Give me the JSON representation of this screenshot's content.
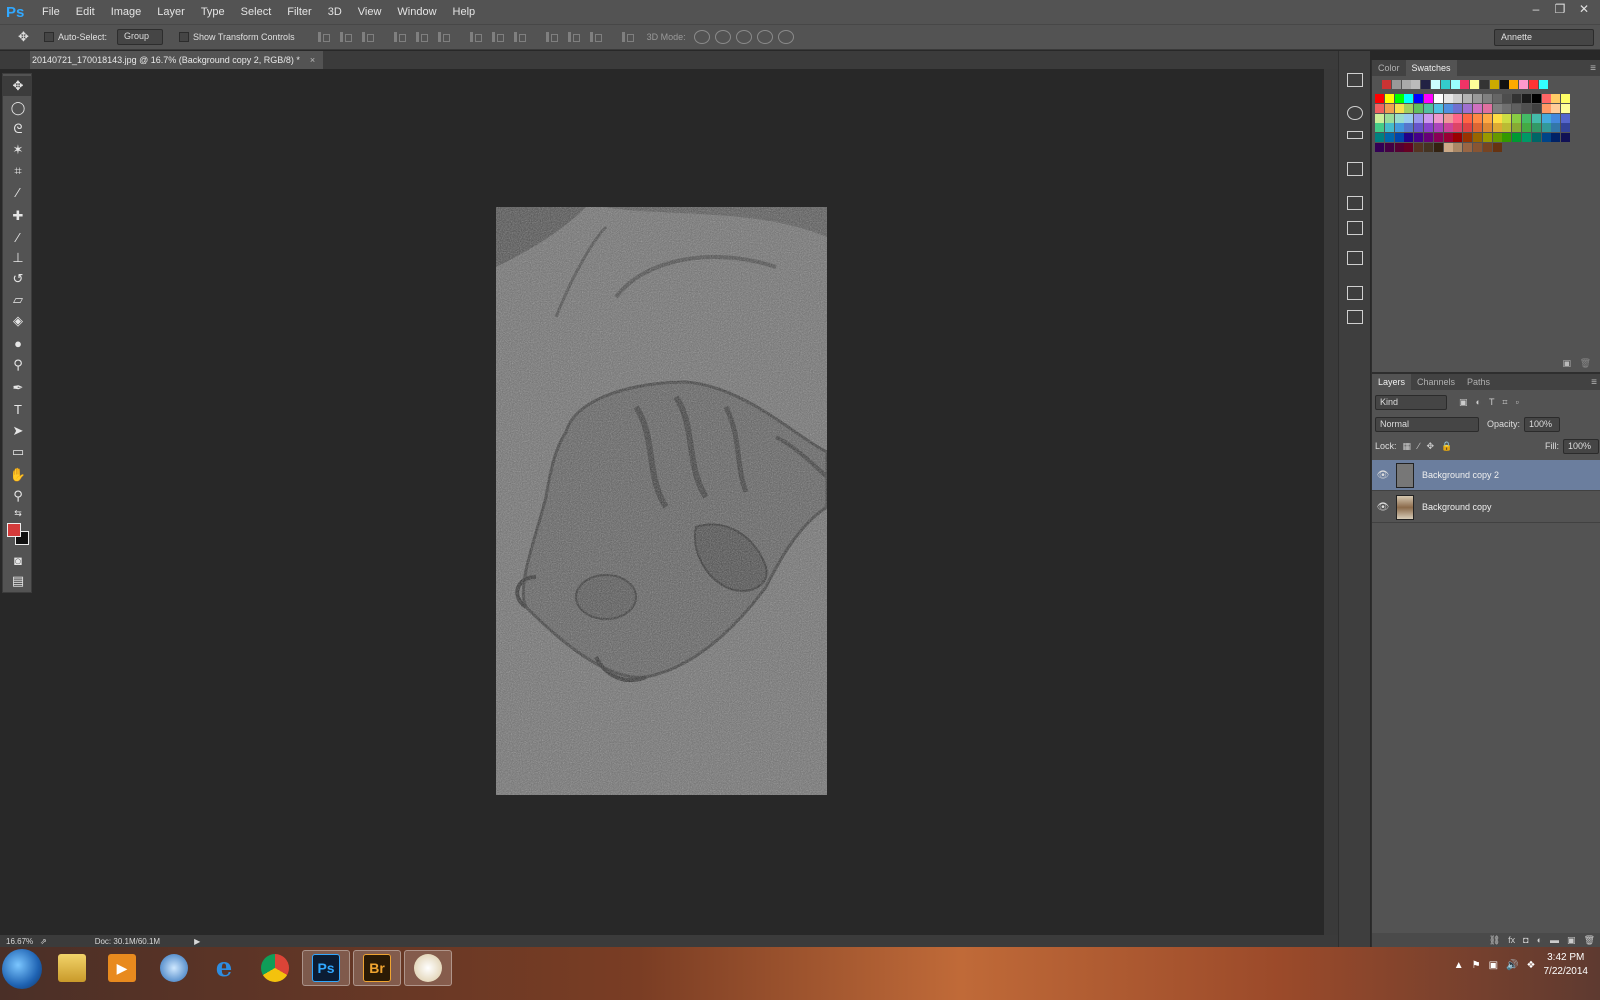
{
  "app": {
    "logo": "Ps",
    "menu": [
      "File",
      "Edit",
      "Image",
      "Layer",
      "Type",
      "Select",
      "Filter",
      "3D",
      "View",
      "Window",
      "Help"
    ],
    "window_controls": [
      "–",
      "❐",
      "✕"
    ]
  },
  "options": {
    "tool_icon": "move-tool-icon",
    "auto_select_label": "Auto-Select:",
    "auto_select_value": "Group",
    "show_transform_label": "Show Transform Controls",
    "mode_3d_label": "3D Mode:",
    "workspace": "Annette"
  },
  "document": {
    "tab_title": "20140721_170018143.jpg @ 16.7% (Background copy 2, RGB/8) *",
    "close": "×"
  },
  "status": {
    "zoom": "16.67%",
    "doc_size": "Doc: 30.1M/60.1M",
    "arrow": "▶"
  },
  "tools": [
    "move-tool",
    "elliptical-marquee-tool",
    "lasso-tool",
    "magic-wand-tool",
    "crop-tool",
    "eyedropper-tool",
    "healing-brush-tool",
    "brush-tool",
    "clone-stamp-tool",
    "history-brush-tool",
    "eraser-tool",
    "paint-bucket-tool",
    "blur-tool",
    "dodge-tool",
    "pen-tool",
    "type-tool",
    "path-selection-tool",
    "rectangle-tool",
    "hand-tool",
    "zoom-tool"
  ],
  "colors": {
    "foreground": "#d43b3b",
    "background": "#111111",
    "layer_selected": "#6b7e9e"
  },
  "swatches_panel": {
    "tabs": [
      "Color",
      "Swatches"
    ],
    "active_tab": "Swatches"
  },
  "layers_panel": {
    "tabs": [
      "Layers",
      "Channels",
      "Paths"
    ],
    "active_tab": "Layers",
    "filter": "Kind",
    "blend_mode": "Normal",
    "opacity_label": "Opacity:",
    "opacity": "100%",
    "lock_label": "Lock:",
    "fill_label": "Fill:",
    "fill": "100%",
    "layers": [
      {
        "name": "Background copy 2",
        "selected": true,
        "visible": true
      },
      {
        "name": "Background copy",
        "selected": false,
        "visible": true
      }
    ]
  },
  "taskbar": {
    "apps": [
      {
        "name": "file-explorer",
        "label": "",
        "open": false
      },
      {
        "name": "media-player",
        "label": "",
        "open": false
      },
      {
        "name": "network-app",
        "label": "",
        "open": false
      },
      {
        "name": "internet-explorer",
        "label": "e",
        "open": false
      },
      {
        "name": "chrome",
        "label": "",
        "open": false
      },
      {
        "name": "photoshop",
        "label": "Ps",
        "open": true
      },
      {
        "name": "bridge",
        "label": "Br",
        "open": true
      },
      {
        "name": "paint",
        "label": "",
        "open": true
      }
    ],
    "time": "3:42 PM",
    "date": "7/22/2014"
  }
}
